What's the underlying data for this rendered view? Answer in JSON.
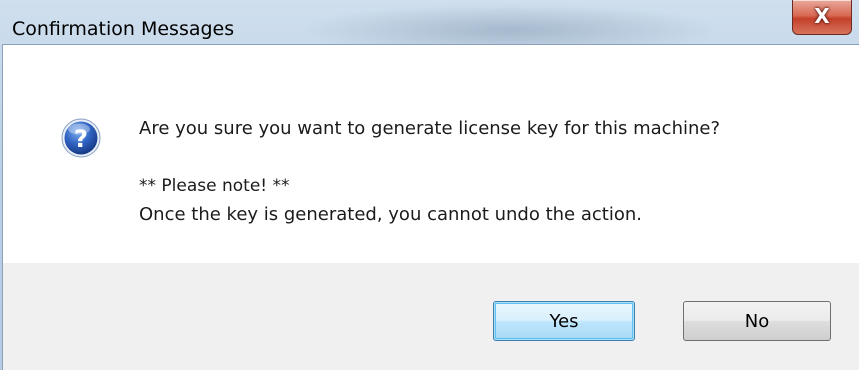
{
  "window": {
    "title": "Confirmation Messages",
    "close_glyph": "X"
  },
  "message": {
    "icon": "question-icon",
    "line1": "Are you sure you want to generate license key for this machine?",
    "line2": "** Please note! **",
    "line3": "Once the key is generated, you cannot undo the action."
  },
  "buttons": {
    "yes_label": "Yes",
    "no_label": "No"
  },
  "colors": {
    "icon_blue": "#2a59b5",
    "close_red": "#c4402a",
    "focus_blue": "#3c7fb1"
  }
}
